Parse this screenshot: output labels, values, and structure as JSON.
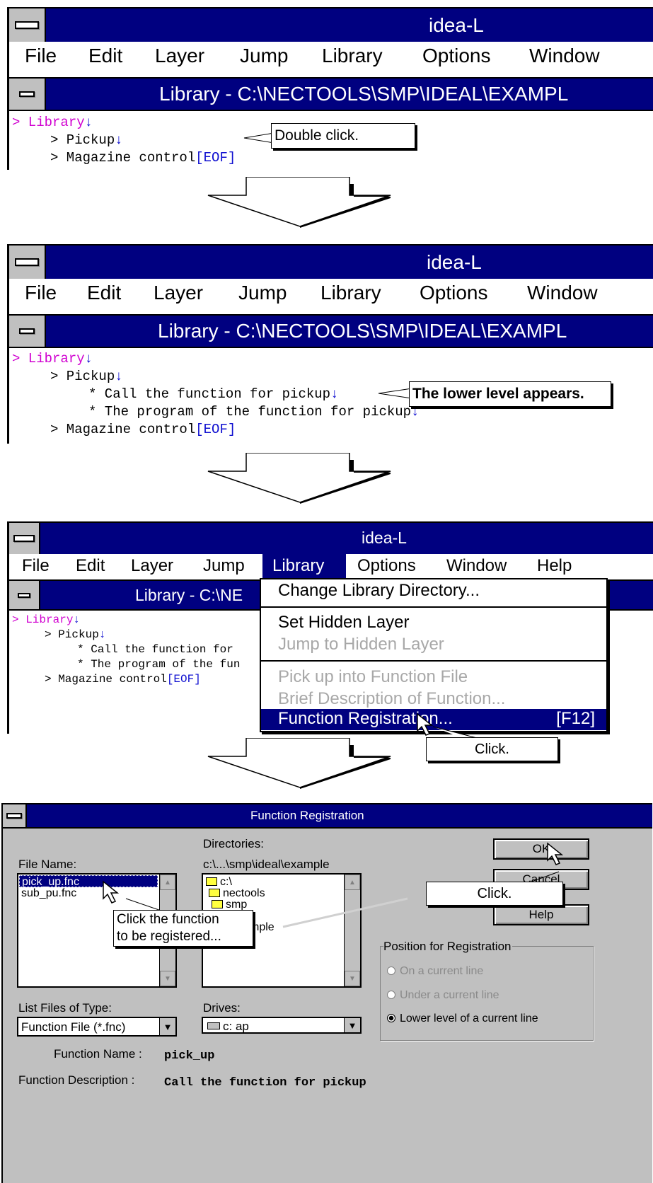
{
  "app_title": "idea-L",
  "menu": {
    "file": "File",
    "edit": "Edit",
    "layer": "Layer",
    "jump": "Jump",
    "library": "Library",
    "options": "Options",
    "window": "Window",
    "help": "Help"
  },
  "doc_title": "Library - C:\\NECTOOLS\\SMP\\IDEAL\\EXAMPL",
  "doc_title_short": "Library - C:\\NE",
  "tree": {
    "library": "> Library",
    "pickup": "> Pickup",
    "call_func": "* Call the function for pickup",
    "call_func_short": "* Call the function for",
    "program_func": "* The program of the function for pickup",
    "program_func_short": "* The program of the fun",
    "magazine": "> Magazine control",
    "eof": "[EOF]",
    "down_mark": "↓"
  },
  "callouts": {
    "double_click": "Double click.",
    "lower_level": "The lower level appears.",
    "click_menu": "Click.",
    "click_ok": "Click.",
    "click_function": "Click the function\nto be registered..."
  },
  "library_menu": {
    "change_dir": "Change Library Directory...",
    "set_hidden": "Set Hidden Layer",
    "jump_hidden": "Jump to Hidden Layer",
    "pick_up": "Pick up into Function File",
    "brief_desc": "Brief Description of Function...",
    "func_reg": "Function Registration...",
    "func_reg_key": "[F12]"
  },
  "dialog": {
    "title": "Function Registration",
    "file_name_label": "File Name:",
    "files": [
      "pick_up.fnc",
      "sub_pu.fnc"
    ],
    "directories_label": "Directories:",
    "dir_path": "c:\\...\\smp\\ideal\\example",
    "dirs": [
      "c:\\",
      "nectools",
      "smp",
      "l",
      "mple"
    ],
    "ok": "OK",
    "cancel": "Cancel",
    "help": "Help",
    "position_group": "Position for Registration",
    "opt_current": "On a current line",
    "opt_under": "Under a current line",
    "opt_lower": "Lower level of a current line",
    "list_type_label": "List Files of Type:",
    "list_type_value": "Function File (*.fnc)",
    "drives_label": "Drives:",
    "drives_value": "c: ap",
    "function_name_label": "Function Name :",
    "function_name_value": "pick_up",
    "function_desc_label": "Function Description :",
    "function_desc_value": "Call the function for pickup"
  }
}
